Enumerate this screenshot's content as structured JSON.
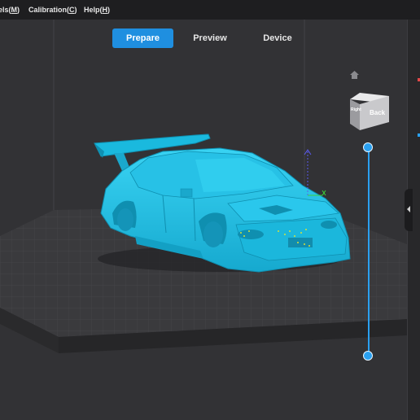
{
  "menu": {
    "items": [
      {
        "label": "els(M)",
        "pre": "els(",
        "key": "M",
        "post": ")"
      },
      {
        "label": "Calibration(C)",
        "pre": "Calibration(",
        "key": "C",
        "post": ")"
      },
      {
        "label": "Help(H)",
        "pre": "Help(",
        "key": "H",
        "post": ")"
      }
    ]
  },
  "tabs": [
    {
      "label": "Prepare",
      "active": true
    },
    {
      "label": "Preview",
      "active": false
    },
    {
      "label": "Device",
      "active": false
    }
  ],
  "view_cube": {
    "front_face": "Back",
    "side_face": "Right"
  },
  "colors": {
    "accent": "#1f8fe0",
    "model": "#1ec5ea",
    "plate": "#3b3b3e",
    "background": "#303033",
    "menubar": "#1e1e20"
  },
  "icons": [
    "home-icon",
    "view-cube-icon",
    "axis-gizmo-icon",
    "collapse-panel-icon"
  ]
}
